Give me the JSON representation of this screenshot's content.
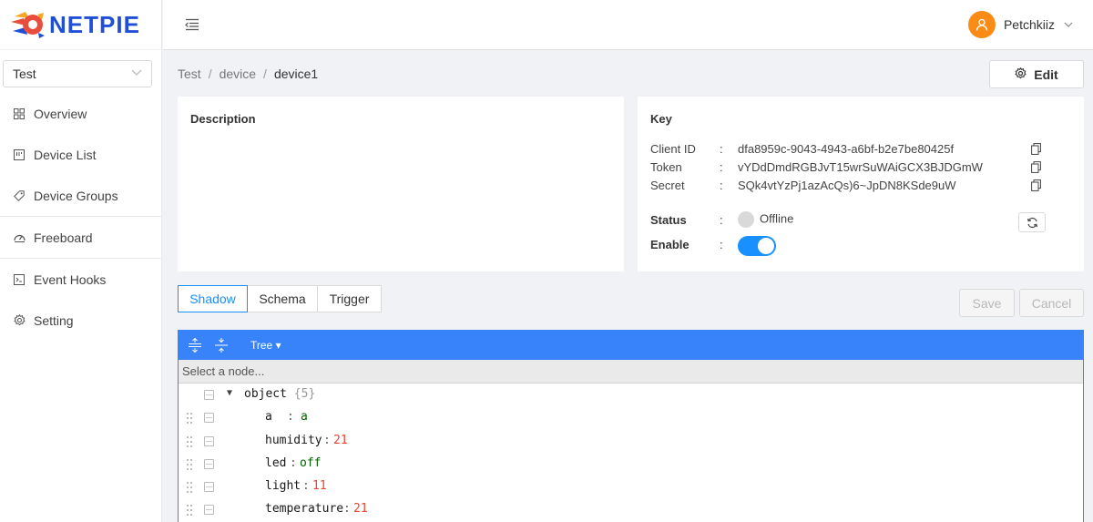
{
  "app": {
    "logo_text": "NETPIE"
  },
  "sidebar": {
    "project": "Test",
    "items": [
      {
        "label": "Overview",
        "icon": "grid-icon"
      },
      {
        "label": "Device List",
        "icon": "device-list-icon"
      },
      {
        "label": "Device Groups",
        "icon": "tag-icon"
      },
      {
        "label": "Freeboard",
        "icon": "gauge-icon"
      },
      {
        "label": "Event Hooks",
        "icon": "terminal-icon"
      },
      {
        "label": "Setting",
        "icon": "gear-icon"
      }
    ]
  },
  "header": {
    "user_name": "Petchkiiz"
  },
  "breadcrumb": [
    "Test",
    "device",
    "device1"
  ],
  "toolbar": {
    "edit_label": "Edit",
    "save_label": "Save",
    "cancel_label": "Cancel"
  },
  "description": {
    "title": "Description"
  },
  "key": {
    "title": "Key",
    "client_id_label": "Client ID",
    "client_id": "dfa8959c-9043-4943-a6bf-b2e7be80425f",
    "token_label": "Token",
    "token": "vYDdDmdRGBJvT15wrSuWAiGCX3BJDGmW",
    "secret_label": "Secret",
    "secret": "SQk4vtYzPj1azAcQs)6~JpDN8KSde9uW",
    "status_label": "Status",
    "status": "Offline",
    "enable_label": "Enable",
    "enabled": true,
    "colon": ":"
  },
  "tabs": [
    {
      "label": "Shadow",
      "active": true
    },
    {
      "label": "Schema",
      "active": false
    },
    {
      "label": "Trigger",
      "active": false
    }
  ],
  "editor": {
    "mode": "Tree ▾",
    "nav_placeholder": "Select a node...",
    "root_label": "object",
    "root_count": "{5}",
    "fields": [
      {
        "key": "a",
        "value": "a",
        "type": "string"
      },
      {
        "key": "humidity",
        "value": "21",
        "type": "number"
      },
      {
        "key": "led",
        "value": "off",
        "type": "string"
      },
      {
        "key": "light",
        "value": "11",
        "type": "number"
      },
      {
        "key": "temperature",
        "value": "21",
        "type": "number"
      }
    ]
  },
  "colors": {
    "accent": "#1890ff",
    "editor_blue": "#3883fa",
    "avatar": "#fa8c16"
  }
}
